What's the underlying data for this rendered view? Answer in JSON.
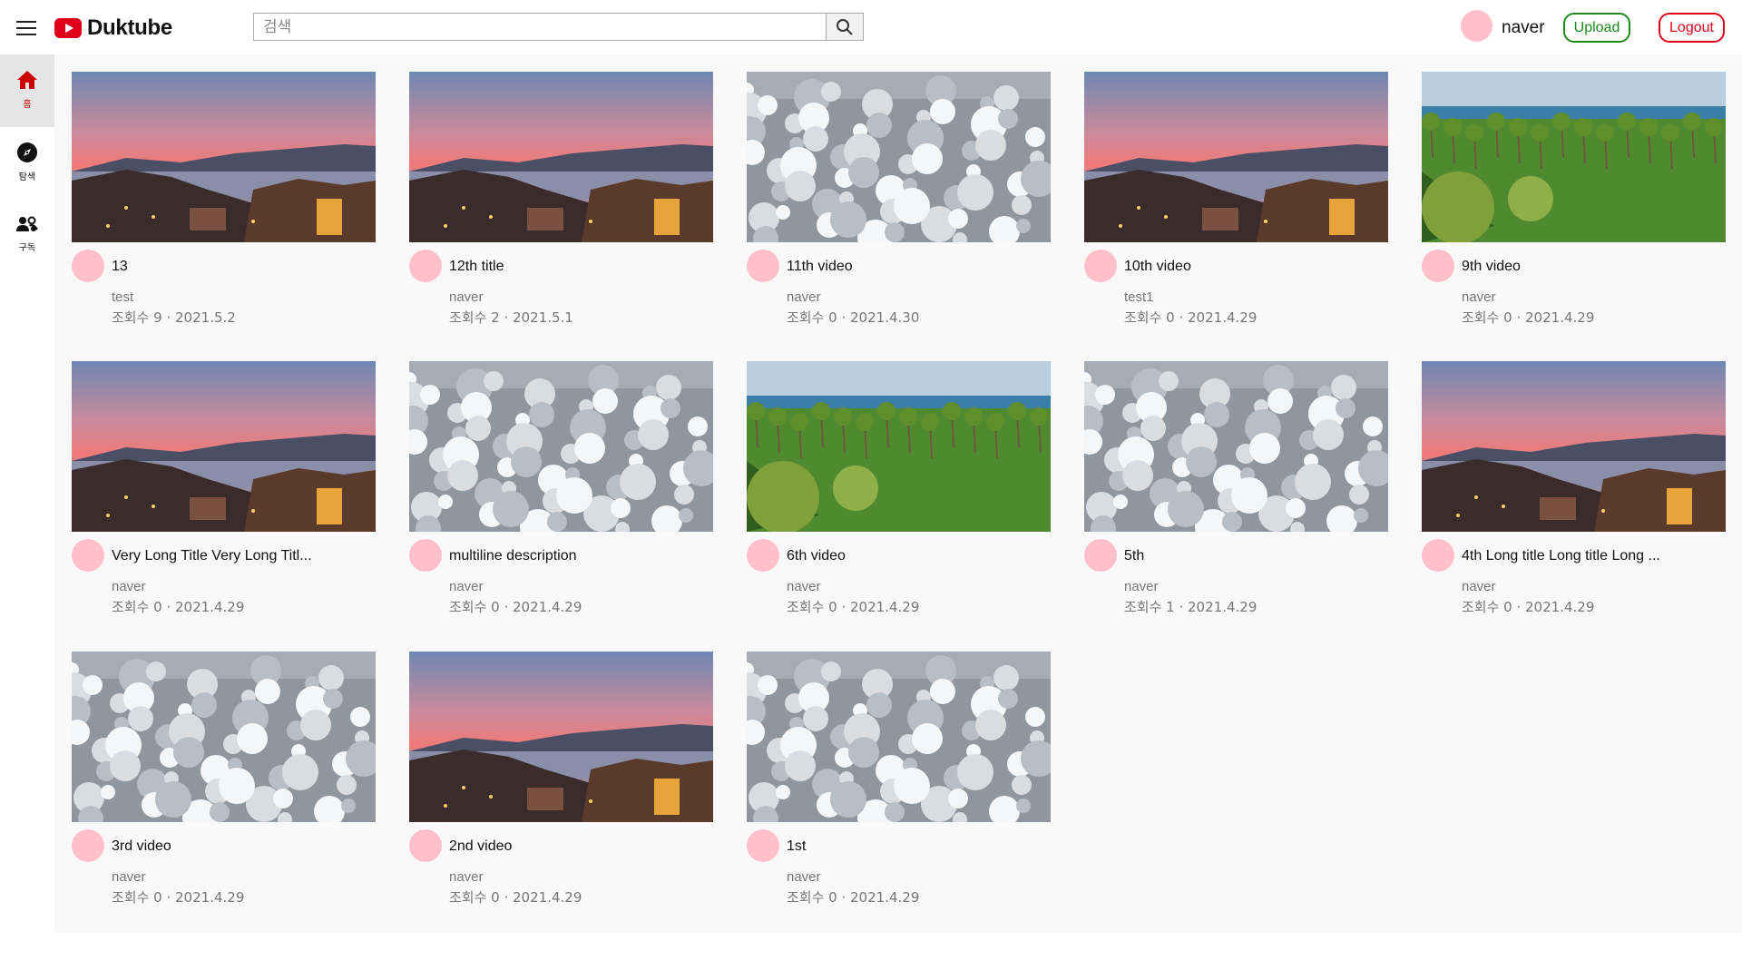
{
  "app": {
    "name": "Duktube"
  },
  "search": {
    "placeholder": "검색"
  },
  "user": {
    "name": "naver"
  },
  "header": {
    "upload_label": "Upload",
    "logout_label": "Logout"
  },
  "sidebar": {
    "items": [
      {
        "label": "홈",
        "icon": "home-icon",
        "active": true
      },
      {
        "label": "탐색",
        "icon": "compass-icon",
        "active": false
      },
      {
        "label": "구독",
        "icon": "subscriptions-icon",
        "active": false
      }
    ]
  },
  "colors": {
    "brand_red": "#e1001c",
    "upload_green": "#1c8a1c",
    "logout_red": "#e3001b",
    "avatar_pink": "#ffc0cb",
    "content_bg": "#f9f9f9"
  },
  "videos": [
    {
      "title": "13",
      "channel": "test",
      "meta": "조회수 9 · 2021.5.2",
      "thumb": "sunset"
    },
    {
      "title": "12th title",
      "channel": "naver",
      "meta": "조회수 2 · 2021.5.1",
      "thumb": "sunset"
    },
    {
      "title": "11th video",
      "channel": "naver",
      "meta": "조회수 0 · 2021.4.30",
      "thumb": "snow"
    },
    {
      "title": "10th video",
      "channel": "test1",
      "meta": "조회수 0 · 2021.4.29",
      "thumb": "sunset"
    },
    {
      "title": "9th video",
      "channel": "naver",
      "meta": "조회수 0 · 2021.4.29",
      "thumb": "palm"
    },
    {
      "title": "Very Long Title Very Long Titl...",
      "channel": "naver",
      "meta": "조회수 0 · 2021.4.29",
      "thumb": "sunset"
    },
    {
      "title": "multiline description",
      "channel": "naver",
      "meta": "조회수 0 · 2021.4.29",
      "thumb": "snow"
    },
    {
      "title": "6th video",
      "channel": "naver",
      "meta": "조회수 0 · 2021.4.29",
      "thumb": "palm"
    },
    {
      "title": "5th",
      "channel": "naver",
      "meta": "조회수 1 · 2021.4.29",
      "thumb": "snow"
    },
    {
      "title": "4th Long title Long title Long ...",
      "channel": "naver",
      "meta": "조회수 0 · 2021.4.29",
      "thumb": "sunset"
    },
    {
      "title": "3rd video",
      "channel": "naver",
      "meta": "조회수 0 · 2021.4.29",
      "thumb": "snow"
    },
    {
      "title": "2nd video",
      "channel": "naver",
      "meta": "조회수 0 · 2021.4.29",
      "thumb": "sunset"
    },
    {
      "title": "1st",
      "channel": "naver",
      "meta": "조회수 0 · 2021.4.29",
      "thumb": "snow"
    }
  ]
}
